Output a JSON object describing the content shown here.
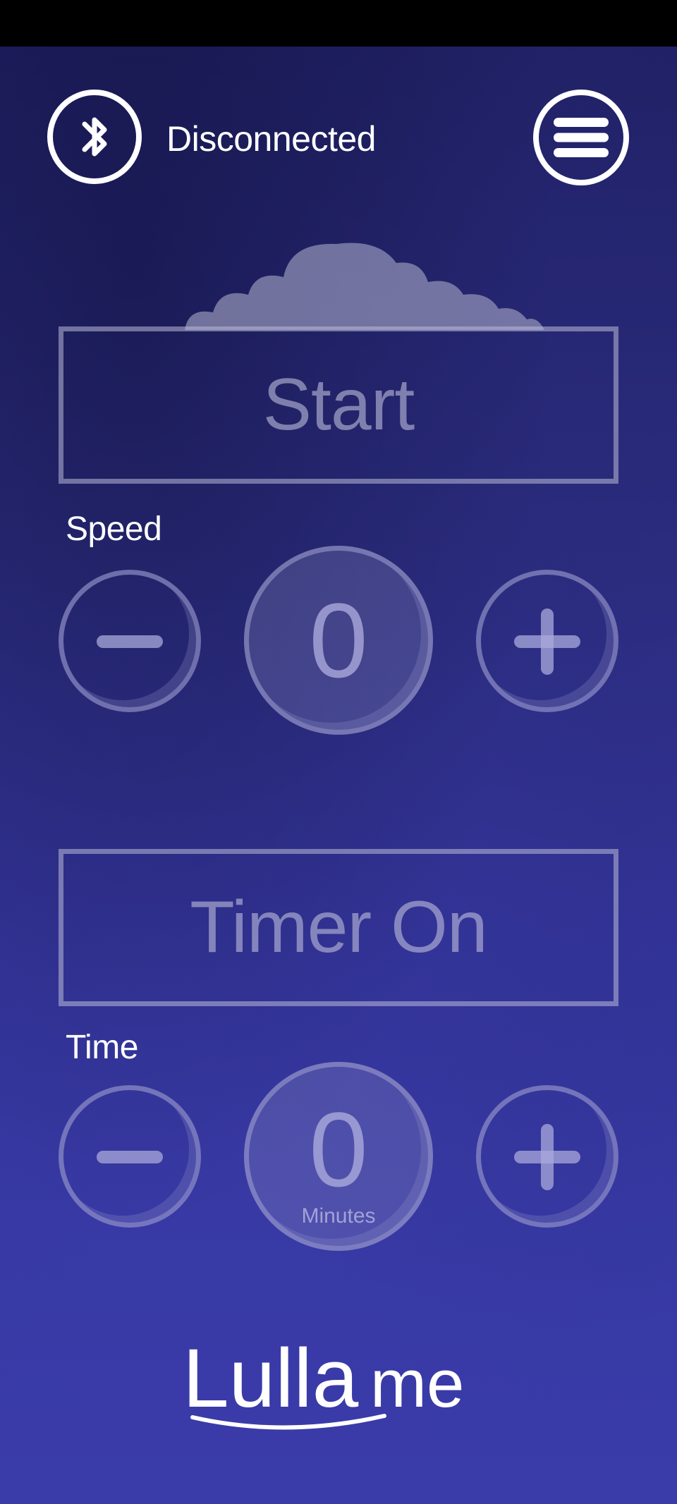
{
  "header": {
    "bluetooth_icon": "bluetooth-icon",
    "status": "Disconnected",
    "menu_icon": "hamburger-menu-icon"
  },
  "start_button": {
    "label": "Start"
  },
  "speed": {
    "label": "Speed",
    "value": "0",
    "decrement_icon": "minus-icon",
    "increment_icon": "plus-icon"
  },
  "timer_button": {
    "label": "Timer On"
  },
  "time": {
    "label": "Time",
    "value": "0",
    "unit": "Minutes",
    "decrement_icon": "minus-icon",
    "increment_icon": "plus-icon"
  },
  "logo": {
    "text_bold": "Lulla",
    "text_light": "me"
  },
  "colors": {
    "accent": "#ffffff",
    "muted": "#9c9ccd",
    "background": "#2c2d80"
  }
}
